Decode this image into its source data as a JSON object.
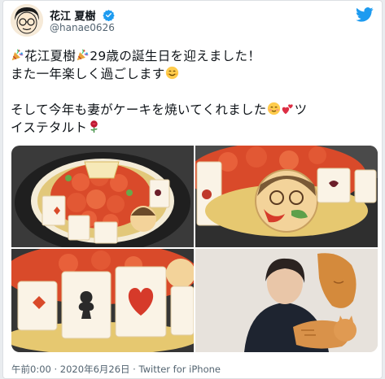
{
  "author": {
    "display_name": "花江 夏樹",
    "handle": "@hanae0626",
    "verified": true
  },
  "tweet": {
    "lines": [
      {
        "before": "",
        "mid": "花江夏樹",
        "after": "29歳の誕生日を迎えました！"
      },
      {
        "text": "また一年楽しく過ごします"
      },
      {
        "text": "そして今年も妻がケーキを焼いてくれました"
      },
      {
        "text": "イステタルト"
      }
    ],
    "line3_tail": "ツ"
  },
  "icons": [
    "party-popper-icon",
    "smiling-face-icon",
    "smiling-blush-icon",
    "two-hearts-icon",
    "rose-icon",
    "verified-badge-icon",
    "twitter-bird-icon"
  ],
  "media": {
    "photos": [
      "cake-top-photo",
      "cake-closeup-photo",
      "cake-side-photo",
      "person-with-cat-photo"
    ]
  },
  "footer": {
    "time": "午前0:00",
    "sep1": "·",
    "date": "2020年6月26日",
    "sep2": "·",
    "source": "Twitter for iPhone"
  },
  "colors": {
    "twitter_blue": "#1d9bf0",
    "text_primary": "#0f1419",
    "text_secondary": "#536471"
  }
}
